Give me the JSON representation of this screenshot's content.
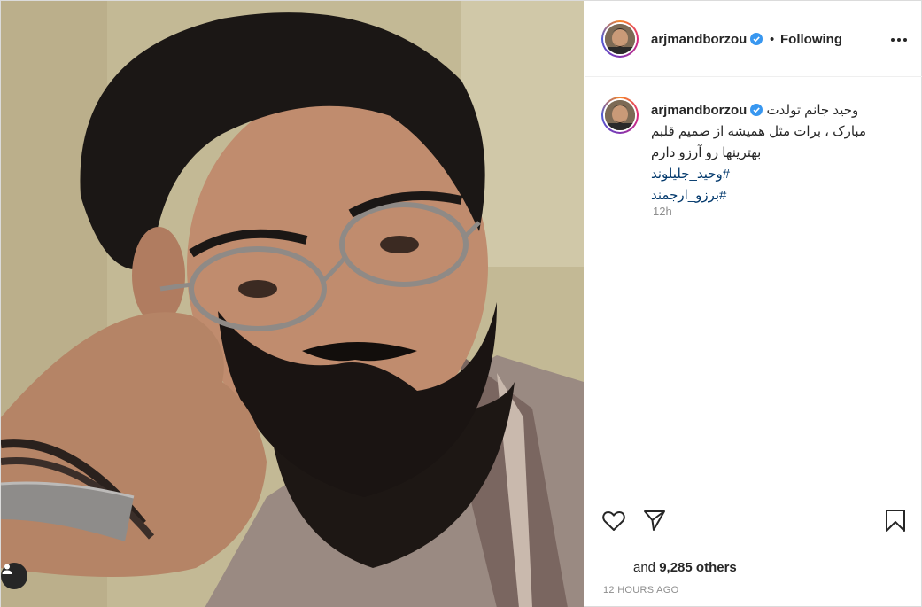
{
  "post": {
    "username": "arjmandborzou",
    "follow_separator": "•",
    "follow_status": "Following",
    "caption": {
      "line1": "وحید جانم تولدت",
      "line2": "مبارک ، برات مثل همیشه از صمیم قلبم",
      "line3": "بهترینها رو آرزو دارم",
      "hashtag1": "#وحید_جلیلوند",
      "hashtag2": "#برزو_ارجمند"
    },
    "comment_time": "12h",
    "likes_prefix": "and",
    "likes_count": "9,285",
    "likes_suffix": "others",
    "posted_ago": "12 HOURS AGO"
  },
  "icons": {
    "verified": "verified-badge-icon",
    "more": "more-options-icon",
    "like": "heart-icon",
    "share": "paper-plane-icon",
    "save": "bookmark-icon",
    "user_tag": "user-tag-icon"
  },
  "colors": {
    "verified": "#3897f0",
    "text": "#262626",
    "muted": "#8e8e8e",
    "hashtag": "#00376b"
  }
}
